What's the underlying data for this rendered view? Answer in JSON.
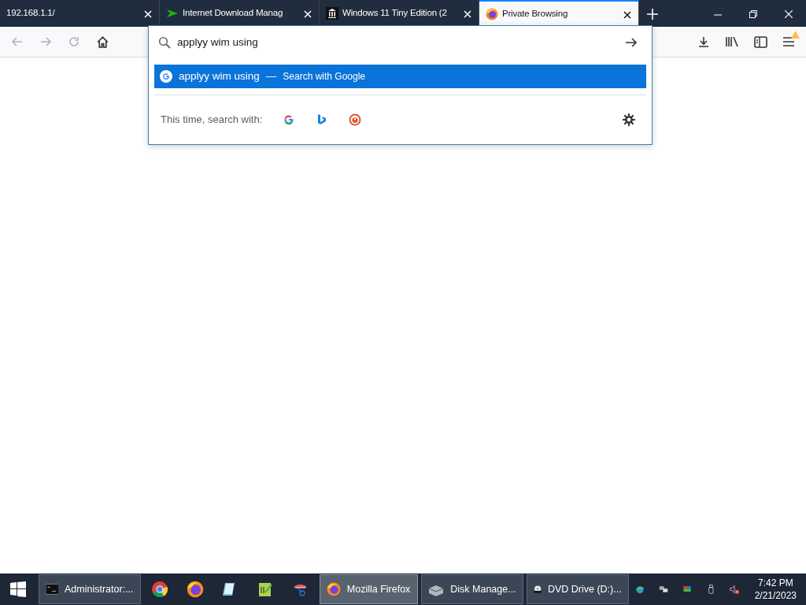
{
  "tabs": [
    {
      "title": "192.168.1.1/",
      "selected": false
    },
    {
      "title": "Internet Download Manag",
      "selected": false
    },
    {
      "title": "Windows 11 Tiny Edition (2",
      "selected": false
    },
    {
      "title": "Private Browsing",
      "selected": true
    }
  ],
  "address_bar": {
    "value": "applyy wim using"
  },
  "suggestions": [
    {
      "text": "applyy wim using",
      "separator": "—",
      "action": "Search with Google",
      "selected": true
    }
  ],
  "one_off_label": "This time, search with:",
  "taskbar": {
    "windows": [
      {
        "label": "Administrator:...",
        "selected": false
      },
      {
        "label": "Mozilla Firefox",
        "selected": true
      },
      {
        "label": "Disk Manage...",
        "selected": false
      },
      {
        "label": "DVD Drive (D:)...",
        "selected": false
      }
    ],
    "time": "7:42 PM",
    "date": "2/21/2023"
  }
}
